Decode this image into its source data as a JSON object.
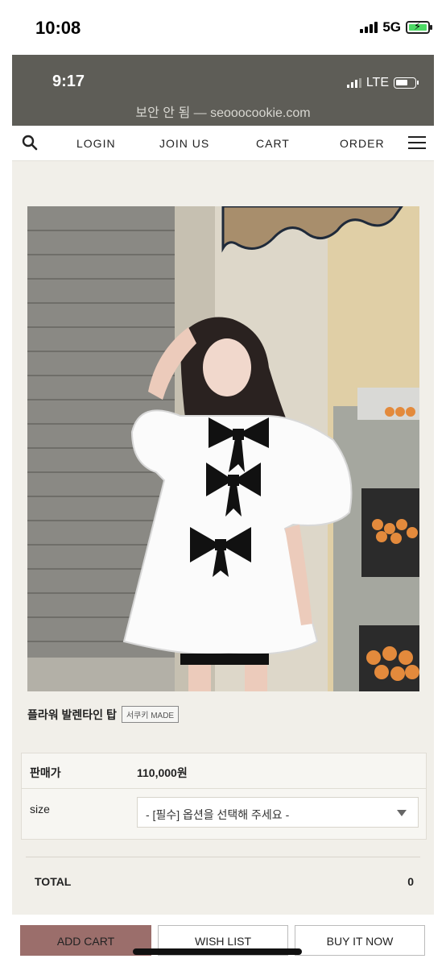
{
  "outer_status": {
    "time": "10:08",
    "network": "5G"
  },
  "inner_status": {
    "time": "9:17",
    "network": "LTE"
  },
  "browser": {
    "url_text": "보안 안 됨 — seooocookie.com"
  },
  "nav": {
    "login": "LOGIN",
    "join": "JOIN US",
    "cart": "CART",
    "order": "ORDER"
  },
  "product": {
    "name": "플라워 발렌타인 탑",
    "badge": "서쿠키 MADE",
    "price_label": "판매가",
    "price": "110,000원",
    "size_label": "size",
    "size_placeholder": "- [필수] 옵션을 선택해 주세요 -",
    "total_label": "TOTAL",
    "total_value": "0"
  },
  "buttons": {
    "add_cart": "ADD CART",
    "wish_list": "WISH LIST",
    "buy_now": "BUY IT NOW"
  },
  "colors": {
    "accent": "#9b6e6b",
    "page_bg": "#f1efe9",
    "inner_status_bg": "#5e5d57"
  }
}
